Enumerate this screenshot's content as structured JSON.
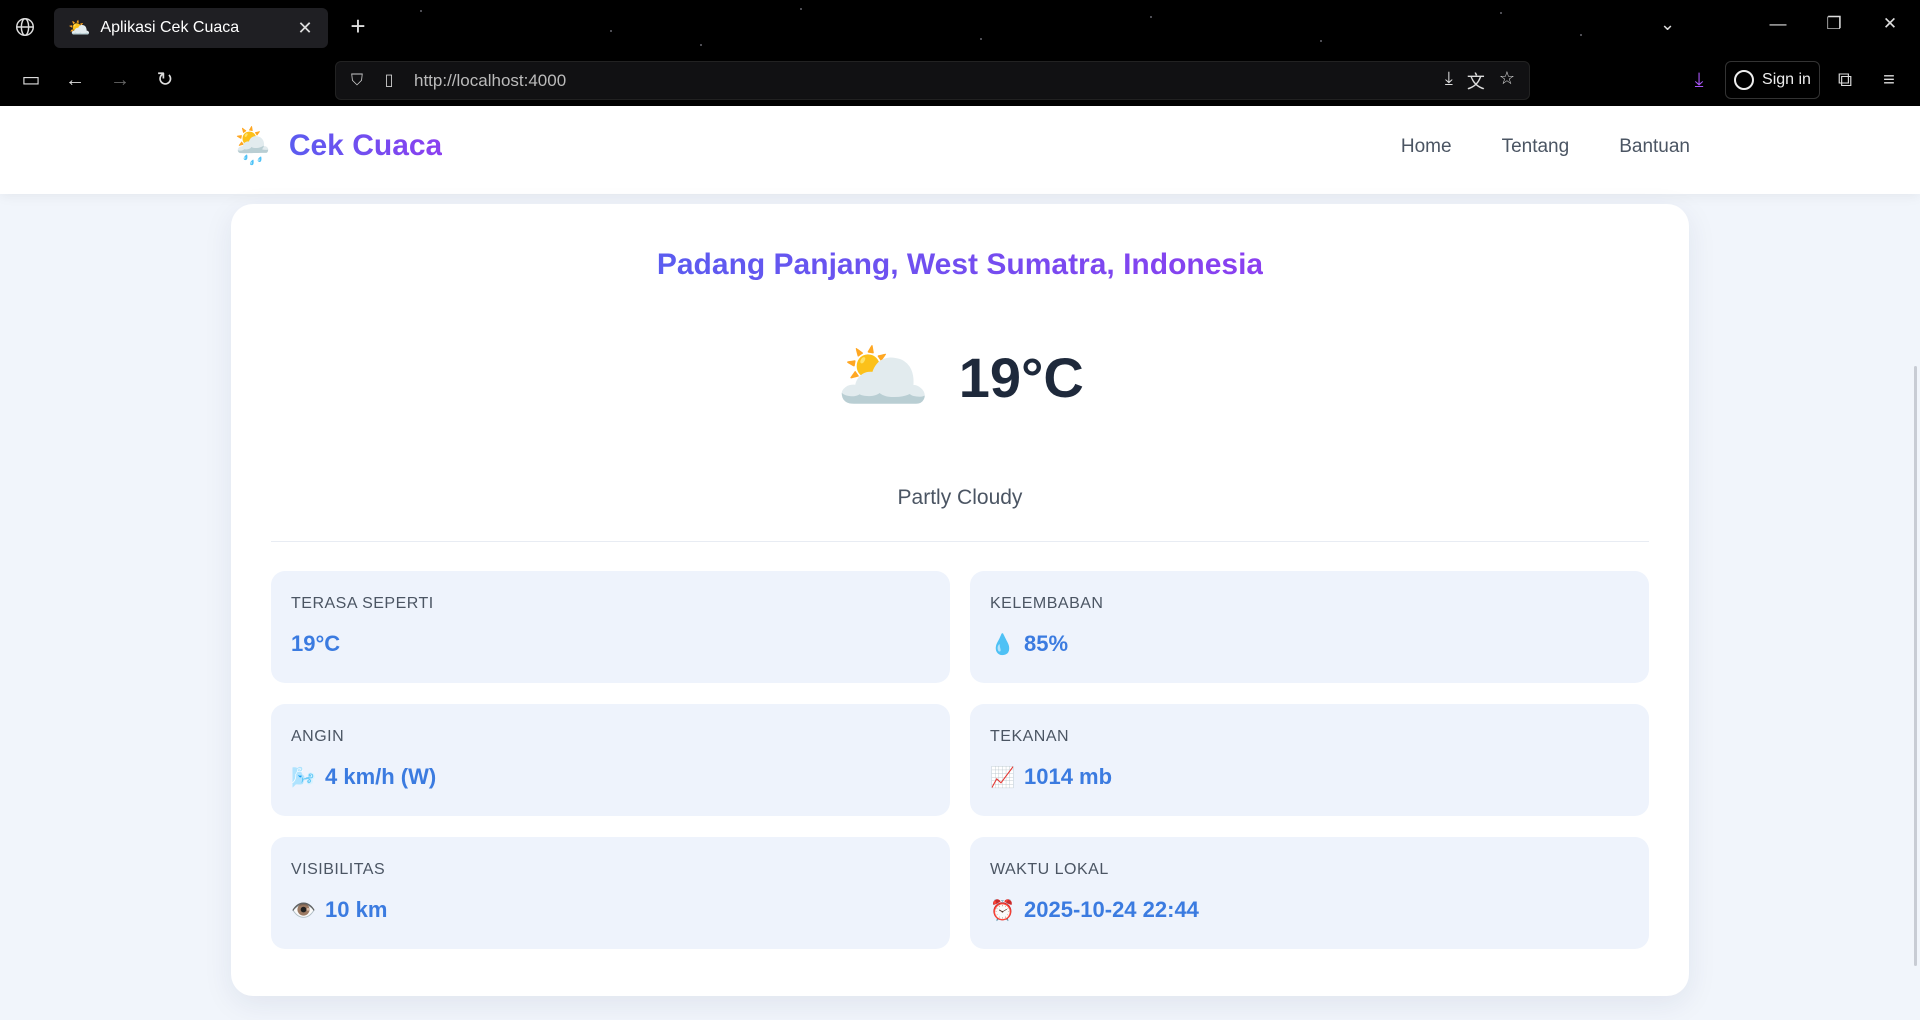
{
  "browser": {
    "tab_title": "Aplikasi Cek Cuaca",
    "tab_favicon": "⛅",
    "url": "http://localhost:4000",
    "sign_in_label": "Sign in"
  },
  "site": {
    "logo_icon": "🌦️",
    "brand": "Cek Cuaca",
    "nav": [
      "Home",
      "Tentang",
      "Bantuan"
    ]
  },
  "weather": {
    "location": "Padang Panjang, West Sumatra, Indonesia",
    "icon": "🌥️",
    "temperature": "19°C",
    "description": "Partly Cloudy",
    "stats": [
      {
        "label": "TERASA SEPERTI",
        "icon": "",
        "value": "19°C"
      },
      {
        "label": "KELEMBABAN",
        "icon": "💧",
        "value": "85%"
      },
      {
        "label": "ANGIN",
        "icon": "🌬️",
        "value": "4 km/h (W)"
      },
      {
        "label": "TEKANAN",
        "icon": "📈",
        "value": "1014 mb"
      },
      {
        "label": "VISIBILITAS",
        "icon": "👁️",
        "value": "10 km"
      },
      {
        "label": "WAKTU LOKAL",
        "icon": "⏰",
        "value": "2025-10-24 22:44"
      }
    ]
  },
  "colors": {
    "accent_start": "#5b5cf0",
    "accent_end": "#8b3ff0",
    "value_blue": "#3b7be0",
    "page_bg": "#f1f5fb",
    "stat_bg": "#eef3fc"
  }
}
